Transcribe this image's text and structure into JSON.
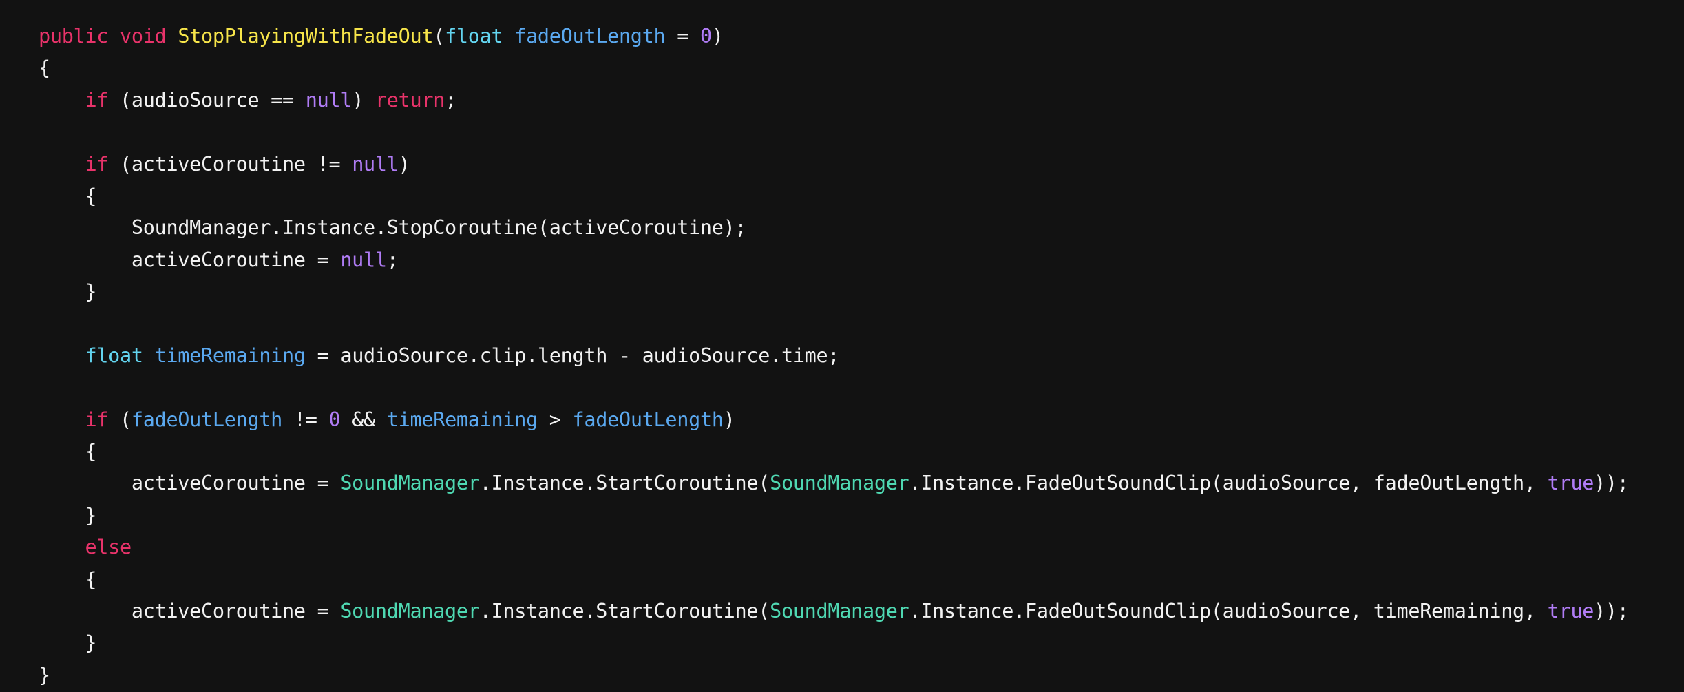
{
  "editor": {
    "background": "#121212",
    "colors": {
      "keyword": "#e8336a",
      "type": "#63d5f0",
      "function": "#f7e54a",
      "variable": "#5ba9f0",
      "literal": "#b07cf5",
      "class": "#4fd8b2",
      "text": "#f2f2f2"
    },
    "lines": [
      [
        [
          "kw",
          "public"
        ],
        [
          "plain",
          " "
        ],
        [
          "kw",
          "void"
        ],
        [
          "plain",
          " "
        ],
        [
          "fn",
          "StopPlayingWithFadeOut"
        ],
        [
          "plain",
          "("
        ],
        [
          "type",
          "float"
        ],
        [
          "plain",
          " "
        ],
        [
          "param",
          "fadeOutLength"
        ],
        [
          "plain",
          " = "
        ],
        [
          "num",
          "0"
        ],
        [
          "plain",
          ")"
        ]
      ],
      [
        [
          "plain",
          "{"
        ]
      ],
      [
        [
          "plain",
          "    "
        ],
        [
          "kw",
          "if"
        ],
        [
          "plain",
          " (audioSource == "
        ],
        [
          "null",
          "null"
        ],
        [
          "plain",
          ") "
        ],
        [
          "kw",
          "return"
        ],
        [
          "plain",
          ";"
        ]
      ],
      [],
      [
        [
          "plain",
          "    "
        ],
        [
          "kw",
          "if"
        ],
        [
          "plain",
          " (activeCoroutine != "
        ],
        [
          "null",
          "null"
        ],
        [
          "plain",
          ")"
        ]
      ],
      [
        [
          "plain",
          "    {"
        ]
      ],
      [
        [
          "plain",
          "        SoundManager.Instance.StopCoroutine(activeCoroutine);"
        ]
      ],
      [
        [
          "plain",
          "        activeCoroutine = "
        ],
        [
          "null",
          "null"
        ],
        [
          "plain",
          ";"
        ]
      ],
      [
        [
          "plain",
          "    }"
        ]
      ],
      [],
      [
        [
          "plain",
          "    "
        ],
        [
          "type",
          "float"
        ],
        [
          "plain",
          " "
        ],
        [
          "param",
          "timeRemaining"
        ],
        [
          "plain",
          " = audioSource.clip.length - audioSource.time;"
        ]
      ],
      [],
      [
        [
          "plain",
          "    "
        ],
        [
          "kw",
          "if"
        ],
        [
          "plain",
          " ("
        ],
        [
          "param",
          "fadeOutLength"
        ],
        [
          "plain",
          " != "
        ],
        [
          "num",
          "0"
        ],
        [
          "plain",
          " && "
        ],
        [
          "param",
          "timeRemaining"
        ],
        [
          "plain",
          " > "
        ],
        [
          "param",
          "fadeOutLength"
        ],
        [
          "plain",
          ")"
        ]
      ],
      [
        [
          "plain",
          "    {"
        ]
      ],
      [
        [
          "plain",
          "        activeCoroutine = "
        ],
        [
          "class",
          "SoundManager"
        ],
        [
          "plain",
          ".Instance.StartCoroutine("
        ],
        [
          "class",
          "SoundManager"
        ],
        [
          "plain",
          ".Instance.FadeOutSoundClip(audioSource, fadeOutLength, "
        ],
        [
          "bool",
          "true"
        ],
        [
          "plain",
          "));"
        ]
      ],
      [
        [
          "plain",
          "    }"
        ]
      ],
      [
        [
          "plain",
          "    "
        ],
        [
          "kw",
          "else"
        ]
      ],
      [
        [
          "plain",
          "    {"
        ]
      ],
      [
        [
          "plain",
          "        activeCoroutine = "
        ],
        [
          "class",
          "SoundManager"
        ],
        [
          "plain",
          ".Instance.StartCoroutine("
        ],
        [
          "class",
          "SoundManager"
        ],
        [
          "plain",
          ".Instance.FadeOutSoundClip(audioSource, timeRemaining, "
        ],
        [
          "bool",
          "true"
        ],
        [
          "plain",
          "));"
        ]
      ],
      [
        [
          "plain",
          "    }"
        ]
      ],
      [
        [
          "plain",
          "}"
        ]
      ]
    ]
  }
}
